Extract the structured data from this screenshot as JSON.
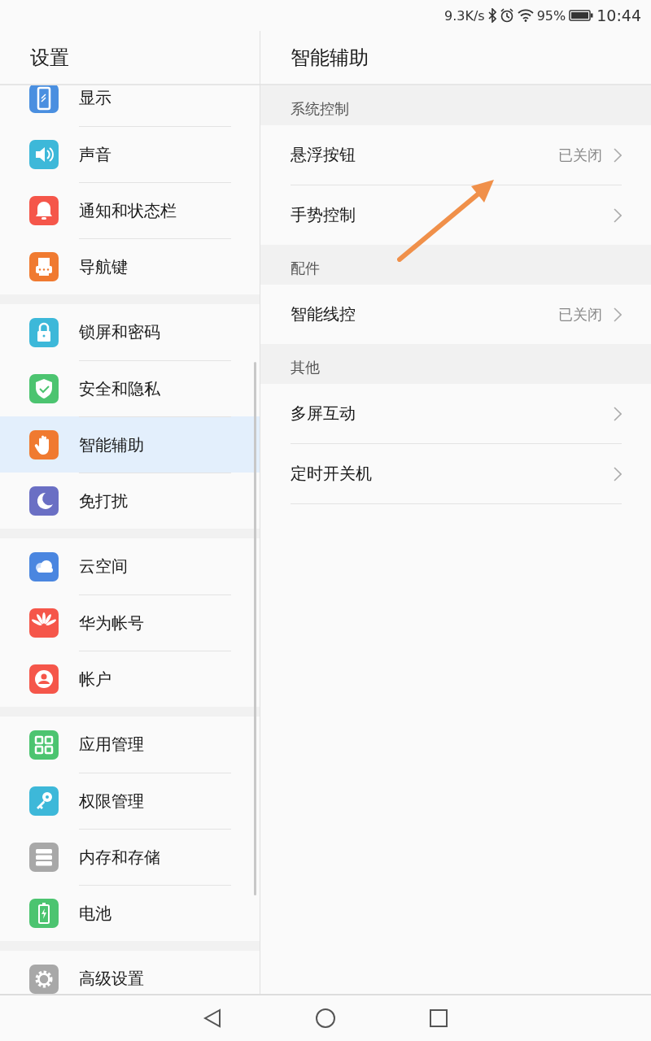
{
  "status_bar": {
    "net_speed": "9.3K/s",
    "battery_percent": "95%",
    "time": "10:44"
  },
  "sidebar": {
    "title": "设置",
    "groups": [
      {
        "items": [
          {
            "label": "显示",
            "selected": false
          },
          {
            "label": "声音",
            "selected": false
          },
          {
            "label": "通知和状态栏",
            "selected": false
          },
          {
            "label": "导航键",
            "selected": false
          }
        ]
      },
      {
        "items": [
          {
            "label": "锁屏和密码",
            "selected": false
          },
          {
            "label": "安全和隐私",
            "selected": false
          },
          {
            "label": "智能辅助",
            "selected": true
          },
          {
            "label": "免打扰",
            "selected": false
          }
        ]
      },
      {
        "items": [
          {
            "label": "云空间",
            "selected": false
          },
          {
            "label": "华为帐号",
            "selected": false
          },
          {
            "label": "帐户",
            "selected": false
          }
        ]
      },
      {
        "items": [
          {
            "label": "应用管理",
            "selected": false
          },
          {
            "label": "权限管理",
            "selected": false
          },
          {
            "label": "内存和存储",
            "selected": false
          },
          {
            "label": "电池",
            "selected": false
          }
        ]
      },
      {
        "items": [
          {
            "label": "高级设置",
            "selected": false
          }
        ]
      }
    ]
  },
  "detail": {
    "title": "智能辅助",
    "sections": [
      {
        "header": "系统控制",
        "rows": [
          {
            "label": "悬浮按钮",
            "value": "已关闭"
          },
          {
            "label": "手势控制"
          }
        ]
      },
      {
        "header": "配件",
        "rows": [
          {
            "label": "智能线控",
            "value": "已关闭"
          }
        ]
      },
      {
        "header": "其他",
        "rows": [
          {
            "label": "多屏互动"
          },
          {
            "label": "定时开关机"
          }
        ]
      }
    ]
  }
}
